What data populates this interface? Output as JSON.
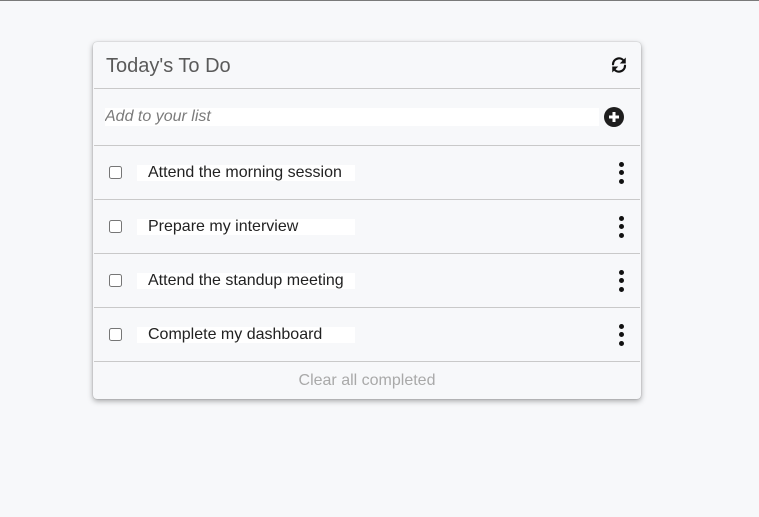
{
  "header": {
    "title": "Today's To Do",
    "refresh_icon": "refresh-icon"
  },
  "add": {
    "placeholder": "Add to your list",
    "button_icon": "plus-circle-icon"
  },
  "items": [
    {
      "label": "Attend the morning session",
      "checked": false
    },
    {
      "label": "Prepare my interview",
      "checked": false
    },
    {
      "label": "Attend the standup meeting",
      "checked": false
    },
    {
      "label": "Complete my dashboard",
      "checked": false
    }
  ],
  "footer": {
    "clear_label": "Clear all completed"
  }
}
